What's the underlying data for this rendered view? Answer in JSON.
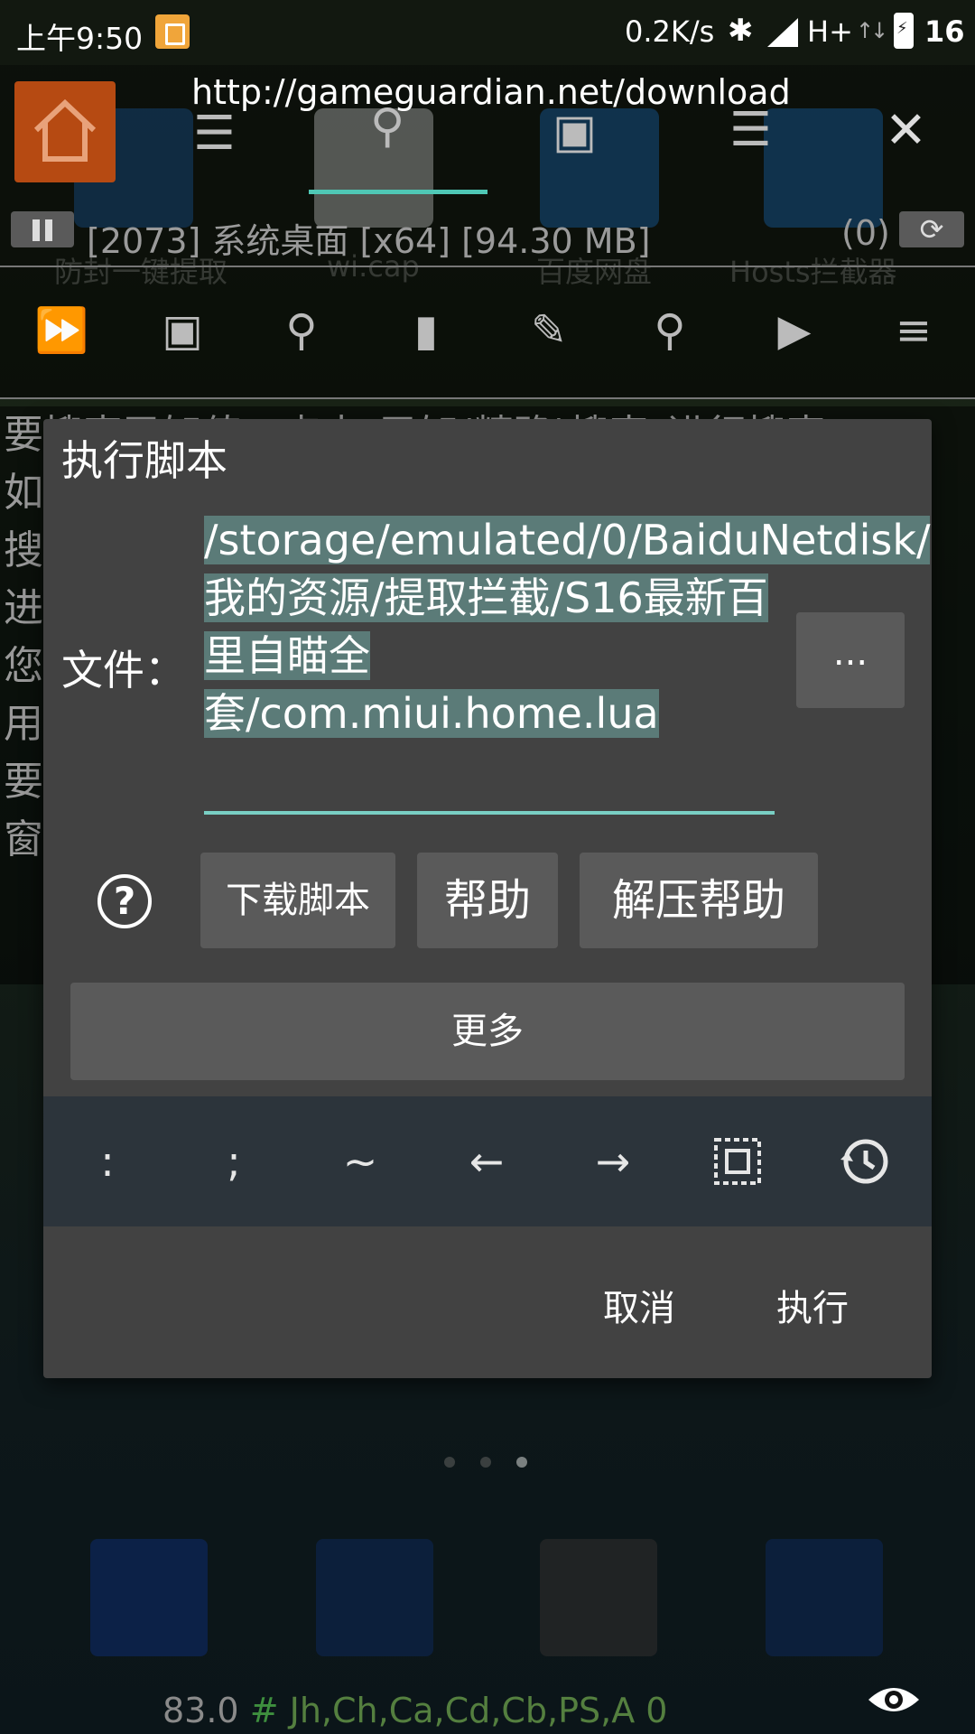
{
  "status_bar": {
    "time": "上午9:50",
    "net_speed": "0.2K/s",
    "network_type": "H+",
    "battery": "16"
  },
  "header": {
    "url": "http://gameguardian.net/download",
    "process": "[2073] 系统桌面 [x64] [94.30 MB]",
    "count": "(0)",
    "bg_labels": [
      "防封一键提取",
      "wi.cap",
      "百度网盘",
      "Hosts拦截器"
    ]
  },
  "background_text": "要搜索已知值，点击\"已知(精确)搜索\"进行搜索\n如果数值未知，使用\"模糊搜索\"或\"范围搜索\"\n搜索之后，可以改变数值来\n进一步过滤结果\n您可以在设置中找到更多，以使\n用\n要\n窗",
  "dialog": {
    "title": "执行脚本",
    "file_label": "文件：",
    "file_path": "/storage/emulated/0/BaiduNetdisk/我的资源/提取拦截/S16最新百里自瞄全套/com.miui.home.lua",
    "browse_label": "...",
    "help_icon_glyph": "?",
    "download_script_label": "下载脚本",
    "help_label": "帮助",
    "unzip_help_label": "解压帮助",
    "more_label": "更多",
    "keys": [
      ":",
      ";",
      "~",
      "←",
      "→"
    ],
    "cancel_label": "取消",
    "execute_label": "执行"
  },
  "footer": {
    "value": "83.0",
    "hash": "#",
    "registers": "Jh,Ch,Ca,Cd,Cb,PS,A 0"
  },
  "colors": {
    "accent": "#79cfc4",
    "selection": "#5b7b78",
    "dialog_bg": "#424242",
    "button_bg": "#5a5a5a",
    "keybar_bg": "#2c343b",
    "home_tile": "#b64a12"
  }
}
